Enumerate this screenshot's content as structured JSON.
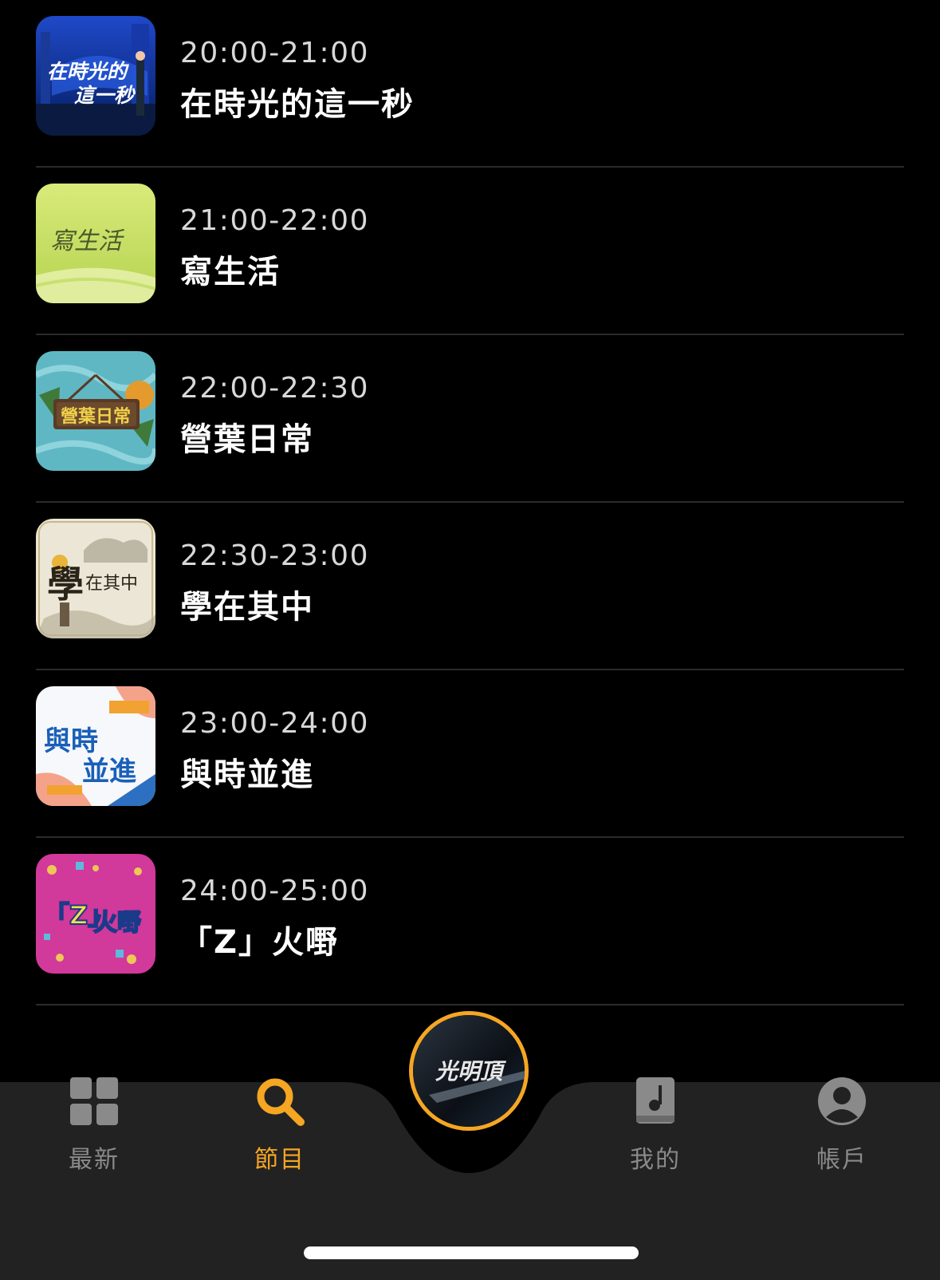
{
  "schedule": [
    {
      "time": "20:00-21:00",
      "title": "在時光的這一秒",
      "thumb_icon": "moment-in-time-program-icon"
    },
    {
      "time": "21:00-22:00",
      "title": "寫生活",
      "thumb_icon": "sketch-life-program-icon"
    },
    {
      "time": "22:00-22:30",
      "title": "營葉日常",
      "thumb_icon": "daily-camp-program-icon"
    },
    {
      "time": "22:30-23:00",
      "title": "學在其中",
      "thumb_icon": "learning-within-program-icon"
    },
    {
      "time": "23:00-24:00",
      "title": "與時並進",
      "thumb_icon": "keep-pace-program-icon"
    },
    {
      "time": "24:00-25:00",
      "title": "「Z」火嘢",
      "thumb_icon": "z-fire-program-icon"
    }
  ],
  "thumb_text": {
    "p1": [
      "在時光的",
      "這一秒"
    ],
    "p2": "寫生活",
    "p3": "營葉日常",
    "p4": [
      "學",
      "在其中"
    ],
    "p5": [
      "與時",
      "並進"
    ],
    "p6": [
      "「Z」",
      "火嘢"
    ]
  },
  "tabbar": {
    "tabs": [
      {
        "label": "最新",
        "icon": "grid-icon",
        "active": false
      },
      {
        "label": "節目",
        "icon": "search-icon",
        "active": true
      },
      {
        "label": "我的",
        "icon": "music-book-icon",
        "active": false
      },
      {
        "label": "帳戶",
        "icon": "account-icon",
        "active": false
      }
    ],
    "center_logo_text": "光明頂"
  },
  "colors": {
    "background": "#000000",
    "tabbar": "#222222",
    "accent": "#f5a623",
    "inactive": "#8a8a8a",
    "separator": "#2b2b2b"
  }
}
